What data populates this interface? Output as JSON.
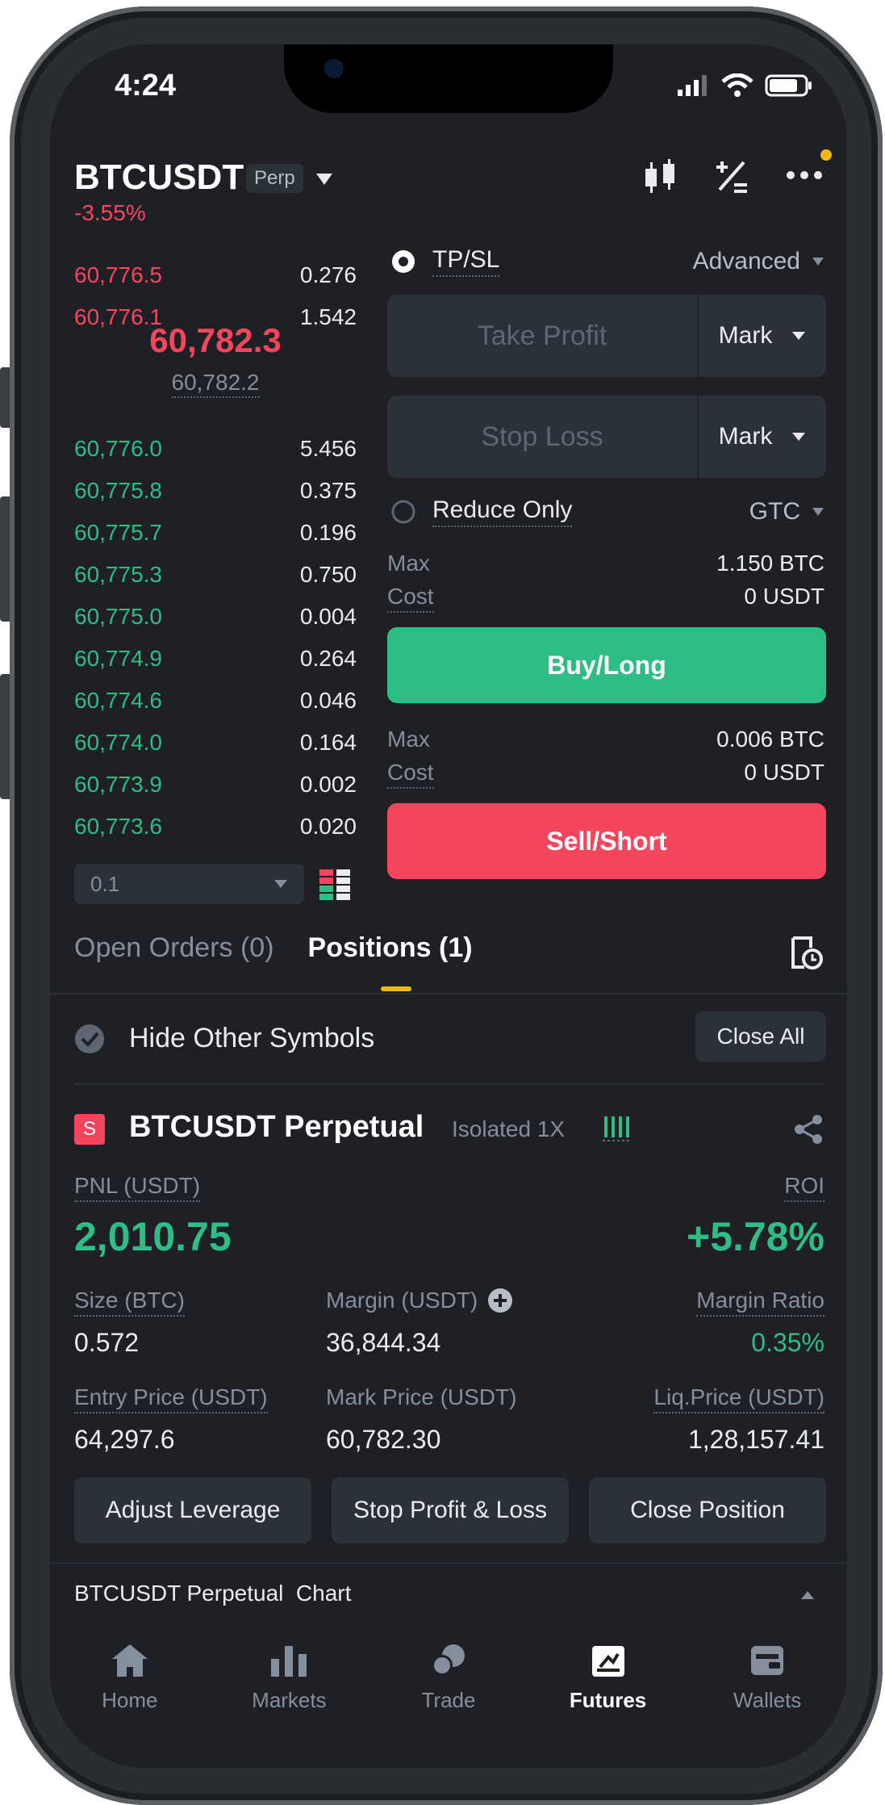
{
  "status": {
    "time": "4:24"
  },
  "header": {
    "symbol": "BTCUSDT",
    "badge": "Perp",
    "change": "-3.55%"
  },
  "orderbook": {
    "asks": [
      {
        "price": "60,776.5",
        "qty": "0.276"
      },
      {
        "price": "60,776.1",
        "qty": "1.542"
      }
    ],
    "last_price": "60,782.3",
    "mark_price": "60,782.2",
    "bids": [
      {
        "price": "60,776.0",
        "qty": "5.456"
      },
      {
        "price": "60,775.8",
        "qty": "0.375"
      },
      {
        "price": "60,775.7",
        "qty": "0.196"
      },
      {
        "price": "60,775.3",
        "qty": "0.750"
      },
      {
        "price": "60,775.0",
        "qty": "0.004"
      },
      {
        "price": "60,774.9",
        "qty": "0.264"
      },
      {
        "price": "60,774.6",
        "qty": "0.046"
      },
      {
        "price": "60,774.0",
        "qty": "0.164"
      },
      {
        "price": "60,773.9",
        "qty": "0.002"
      },
      {
        "price": "60,773.6",
        "qty": "0.020"
      }
    ],
    "depth_step": "0.1"
  },
  "order_form": {
    "tpsl_label": "TP/SL",
    "advanced_label": "Advanced",
    "take_profit_placeholder": "Take Profit",
    "stop_loss_placeholder": "Stop Loss",
    "trigger_type": "Mark",
    "reduce_only_label": "Reduce Only",
    "tif": "GTC",
    "buy": {
      "max_label": "Max",
      "max_value": "1.150 BTC",
      "cost_label": "Cost",
      "cost_value": "0 USDT",
      "button": "Buy/Long"
    },
    "sell": {
      "max_label": "Max",
      "max_value": "0.006 BTC",
      "cost_label": "Cost",
      "cost_value": "0 USDT",
      "button": "Sell/Short"
    }
  },
  "tabs": {
    "open_orders": "Open Orders (0)",
    "positions": "Positions (1)"
  },
  "positions_bar": {
    "hide_label": "Hide Other Symbols",
    "close_all": "Close All"
  },
  "position": {
    "side_badge": "S",
    "title": "BTCUSDT Perpetual",
    "mode": "Isolated 1X",
    "pnl_label": "PNL (USDT)",
    "pnl_value": "2,010.75",
    "roi_label": "ROI",
    "roi_value": "+5.78%",
    "size_label": "Size (BTC)",
    "size_value": "0.572",
    "margin_label": "Margin (USDT)",
    "margin_value": "36,844.34",
    "margin_ratio_label": "Margin Ratio",
    "margin_ratio_value": "0.35%",
    "entry_label": "Entry Price (USDT)",
    "entry_value": "64,297.6",
    "mark_label": "Mark Price (USDT)",
    "mark_value": "60,782.30",
    "liq_label": "Liq.Price (USDT)",
    "liq_value": "1,28,157.41",
    "actions": [
      "Adjust Leverage",
      "Stop Profit & Loss",
      "Close Position"
    ]
  },
  "chart_bar": {
    "label": "BTCUSDT Perpetual  Chart"
  },
  "nav": [
    {
      "label": "Home",
      "icon": "home-icon"
    },
    {
      "label": "Markets",
      "icon": "markets-icon"
    },
    {
      "label": "Trade",
      "icon": "trade-icon"
    },
    {
      "label": "Futures",
      "icon": "futures-icon",
      "active": true
    },
    {
      "label": "Wallets",
      "icon": "wallet-icon"
    }
  ],
  "colors": {
    "green": "#2ebd85",
    "red": "#f6465d",
    "accent": "#f0b90b",
    "bg": "#1e2026"
  }
}
